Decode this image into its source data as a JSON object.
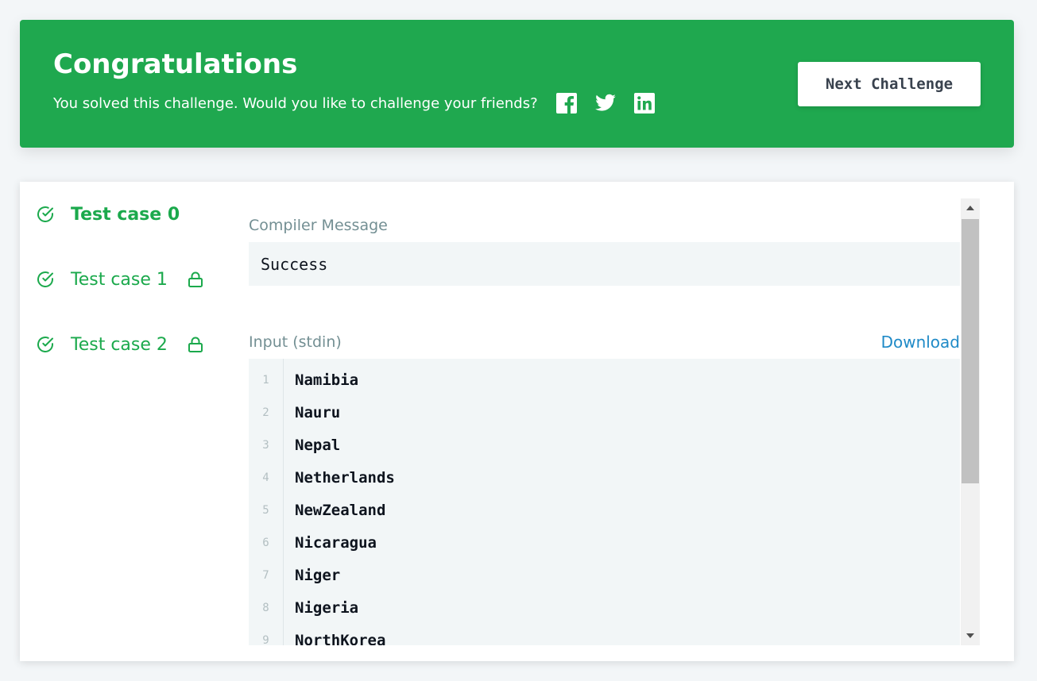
{
  "banner": {
    "title": "Congratulations",
    "message": "You solved this challenge. Would you like to challenge your friends?",
    "share_icons": [
      "facebook-icon",
      "twitter-icon",
      "linkedin-icon"
    ],
    "next_button_label": "Next Challenge",
    "background_color": "#1fa84f"
  },
  "test_cases": [
    {
      "label": "Test case 0",
      "status": "passed",
      "active": true,
      "locked": false
    },
    {
      "label": "Test case 1",
      "status": "passed",
      "active": false,
      "locked": true
    },
    {
      "label": "Test case 2",
      "status": "passed",
      "active": false,
      "locked": true
    }
  ],
  "compiler": {
    "label": "Compiler Message",
    "message": "Success"
  },
  "input": {
    "label": "Input (stdin)",
    "download_label": "Download",
    "lines": [
      {
        "num": "1",
        "text": "Namibia"
      },
      {
        "num": "2",
        "text": "Nauru"
      },
      {
        "num": "3",
        "text": "Nepal"
      },
      {
        "num": "4",
        "text": "Netherlands"
      },
      {
        "num": "5",
        "text": "NewZealand"
      },
      {
        "num": "6",
        "text": "Nicaragua"
      },
      {
        "num": "7",
        "text": "Niger"
      },
      {
        "num": "8",
        "text": "Nigeria"
      },
      {
        "num": "9",
        "text": "NorthKorea"
      }
    ]
  },
  "colors": {
    "success_green": "#1ba94c",
    "link_blue": "#1f8ac7",
    "code_bg": "#f2f6f7"
  }
}
